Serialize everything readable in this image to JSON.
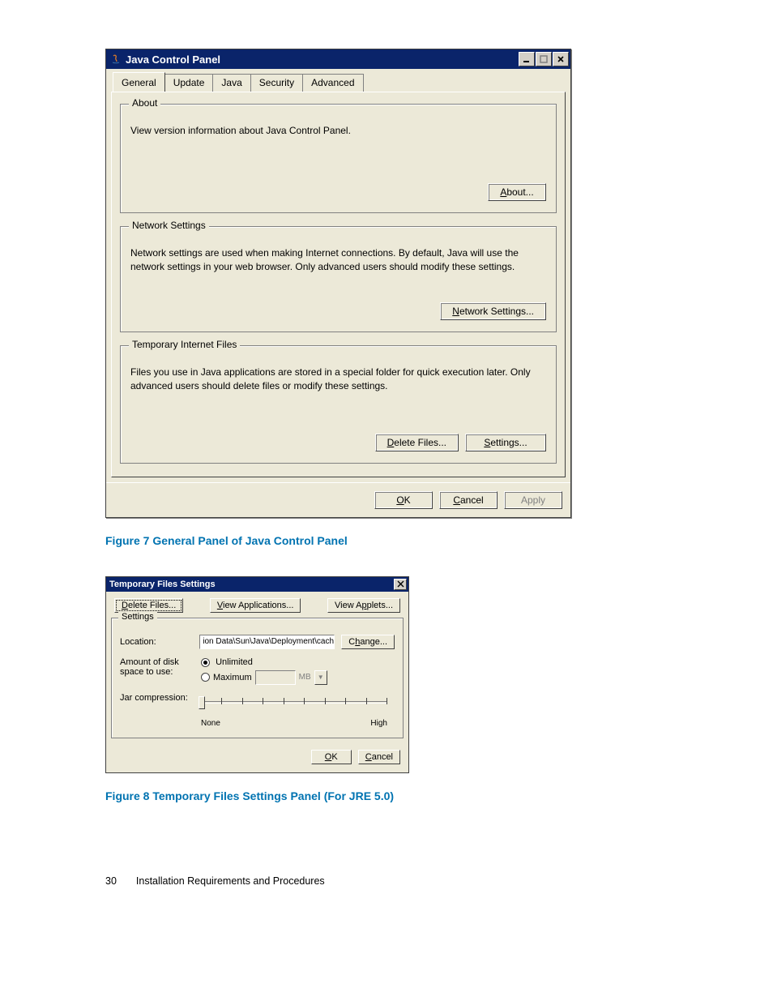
{
  "fig1": {
    "window_title": "Java Control Panel",
    "tabs": [
      "General",
      "Update",
      "Java",
      "Security",
      "Advanced"
    ],
    "about": {
      "legend": "About",
      "text": "View version information about Java Control Panel.",
      "button": "About..."
    },
    "network": {
      "legend": "Network Settings",
      "text": "Network settings are used when making Internet connections.  By default, Java will use the network settings in your web browser.  Only advanced users should modify these settings.",
      "button": "Network Settings..."
    },
    "temp": {
      "legend": "Temporary Internet Files",
      "text": "Files you use in Java applications are stored in a special folder for quick execution later.  Only advanced users should delete files or modify these settings.",
      "delete_button": "Delete Files...",
      "settings_button": "Settings..."
    },
    "ok": "OK",
    "cancel": "Cancel",
    "apply": "Apply",
    "caption": "Figure 7 General Panel of Java Control Panel"
  },
  "fig2": {
    "window_title": "Temporary Files Settings",
    "delete_files": "Delete Files...",
    "view_apps": "View Applications...",
    "view_applets": "View Applets...",
    "settings_legend": "Settings",
    "location_label": "Location:",
    "location_value": "ion Data\\Sun\\Java\\Deployment\\cache",
    "change": "Change...",
    "amount_label_1": "Amount of disk",
    "amount_label_2": "space to use:",
    "unlimited": "Unlimited",
    "maximum": "Maximum",
    "mb_unit": "MB",
    "jar_label": "Jar compression:",
    "slider_none": "None",
    "slider_high": "High",
    "ok": "OK",
    "cancel": "Cancel",
    "caption": "Figure 8 Temporary Files Settings Panel (For JRE 5.0)"
  },
  "footer": {
    "page_number": "30",
    "section": "Installation Requirements and Procedures"
  }
}
